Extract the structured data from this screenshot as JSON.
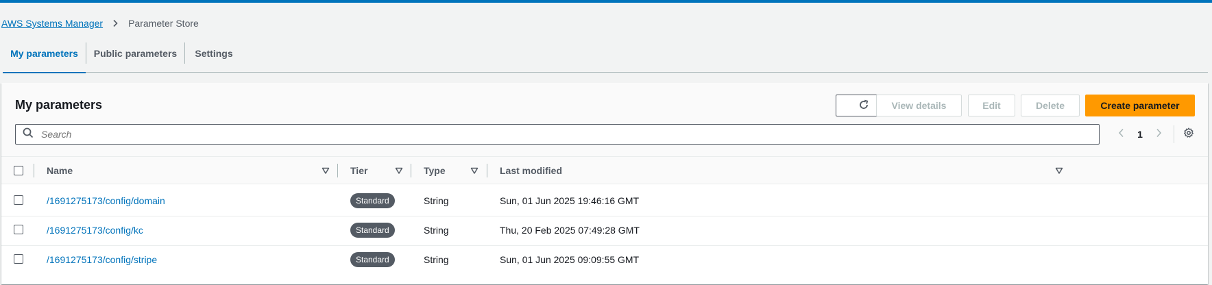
{
  "breadcrumb": {
    "root": "AWS Systems Manager",
    "current": "Parameter Store"
  },
  "tabs": [
    {
      "label": "My parameters",
      "active": true
    },
    {
      "label": "Public parameters",
      "active": false
    },
    {
      "label": "Settings",
      "active": false
    }
  ],
  "panel": {
    "title": "My parameters",
    "buttons": {
      "refresh_icon": "refresh-icon",
      "view_details": "View details",
      "edit": "Edit",
      "delete": "Delete",
      "create": "Create parameter"
    }
  },
  "search": {
    "placeholder": "Search",
    "value": ""
  },
  "pagination": {
    "current_page": "1"
  },
  "table": {
    "columns": [
      "Name",
      "Tier",
      "Type",
      "Last modified"
    ],
    "rows": [
      {
        "name": "/1691275173/config/domain",
        "tier": "Standard",
        "type": "String",
        "last_modified": "Sun, 01 Jun 2025 19:46:16 GMT"
      },
      {
        "name": "/1691275173/config/kc",
        "tier": "Standard",
        "type": "String",
        "last_modified": "Thu, 20 Feb 2025 07:49:28 GMT"
      },
      {
        "name": "/1691275173/config/stripe",
        "tier": "Standard",
        "type": "String",
        "last_modified": "Sun, 01 Jun 2025 09:09:55 GMT"
      }
    ]
  },
  "colors": {
    "accent": "#0073bb",
    "primary_button": "#ff9900",
    "badge": "#545b64"
  }
}
